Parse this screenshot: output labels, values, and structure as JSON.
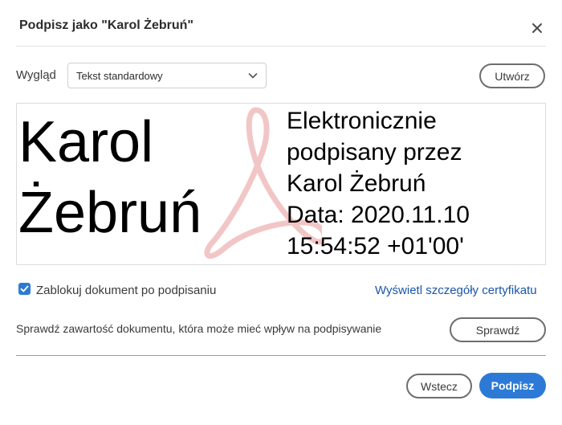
{
  "dialog": {
    "title": "Podpisz jako \"Karol Żebruń\""
  },
  "appearance": {
    "label": "Wygląd",
    "selected": "Tekst standardowy",
    "create_label": "Utwórz"
  },
  "signature": {
    "name_lines": [
      "Karol",
      "Żebruń"
    ],
    "detail_lines": [
      "Elektronicznie",
      "podpisany przez",
      "Karol Żebruń",
      "Data: 2020.11.10",
      "15:54:52 +01'00'"
    ]
  },
  "options": {
    "lock_document_label": "Zablokuj dokument po podpisaniu",
    "lock_document_checked": true,
    "certificate_link": "Wyświetl szczegóły certyfikatu"
  },
  "verify": {
    "text": "Sprawdź zawartość dokumentu, która może mieć wpływ na podpisywanie",
    "button_label": "Sprawdź"
  },
  "footer": {
    "back_label": "Wstecz",
    "sign_label": "Podpisz"
  },
  "colors": {
    "accent": "#2d7ad6",
    "link": "#1a56a8",
    "watermark": "#f2c6c6"
  },
  "icons": {
    "close": "close-icon",
    "chevron": "chevron-down-icon",
    "checkbox": "checkmark-icon",
    "watermark": "acrobat-logo-icon"
  }
}
